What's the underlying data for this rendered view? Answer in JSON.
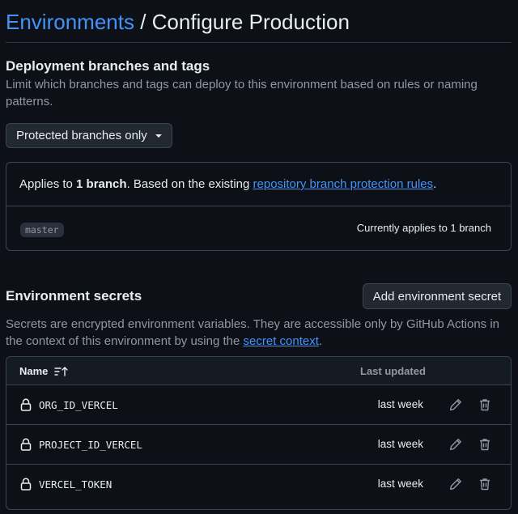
{
  "header": {
    "breadcrumb_link": "Environments",
    "separator": " / ",
    "title": "Configure Production"
  },
  "deployment": {
    "heading": "Deployment branches and tags",
    "description": "Limit which branches and tags can deploy to this environment based on rules or naming patterns.",
    "dropdown_value": "Protected branches only",
    "panel": {
      "applies_prefix": "Applies to ",
      "applies_count": "1 branch",
      "applies_mid": ". Based on the existing ",
      "applies_link": "repository branch protection rules",
      "applies_suffix": ".",
      "branch": "master",
      "status": "Currently applies to 1 branch"
    }
  },
  "secrets": {
    "heading": "Environment secrets",
    "add_button": "Add environment secret",
    "description_prefix": "Secrets are encrypted environment variables. They are accessible only by GitHub Actions in the context of this environment by using the ",
    "description_link": "secret context",
    "description_suffix": ".",
    "columns": {
      "name": "Name",
      "updated": "Last updated"
    },
    "rows": [
      {
        "name": "ORG_ID_VERCEL",
        "updated": "last week"
      },
      {
        "name": "PROJECT_ID_VERCEL",
        "updated": "last week"
      },
      {
        "name": "VERCEL_TOKEN",
        "updated": "last week"
      }
    ]
  },
  "colors": {
    "background": "#0d1117",
    "accent_link": "#4493f8",
    "border": "#3d444d",
    "muted_text": "#9198a1"
  },
  "icons": [
    "caret-down-icon",
    "sort-ascending-icon",
    "lock-icon",
    "pencil-icon",
    "trash-icon"
  ]
}
